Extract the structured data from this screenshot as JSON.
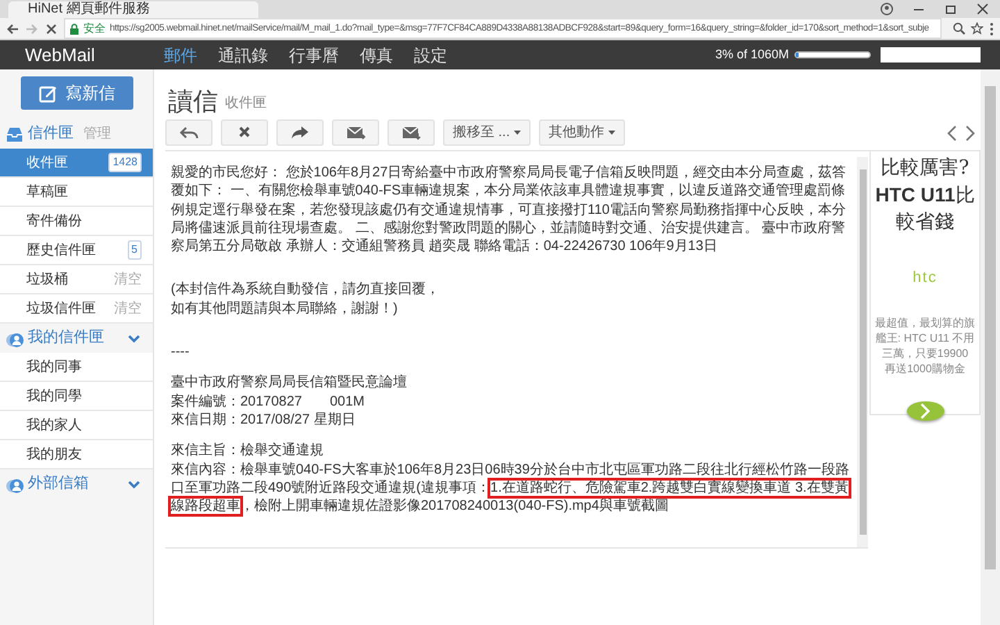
{
  "browser": {
    "tab_title": "HiNet 網頁郵件服務",
    "security_label": "安全",
    "url": "https://sg2005.webmail.hinet.net/mailService/mail/M_mail_1.do?mail_type=&msg=77F7CF84CA889D4338A88138ADBCF928&start=89&query_form=16&query_string=&folder_id=170&sort_method=1&sort_subje"
  },
  "navbar": {
    "brand": "WebMail",
    "items": [
      {
        "label": "郵件",
        "selected": true
      },
      {
        "label": "通訊錄",
        "selected": false
      },
      {
        "label": "行事曆",
        "selected": false
      },
      {
        "label": "傳真",
        "selected": false
      },
      {
        "label": "設定",
        "selected": false
      }
    ],
    "quota": {
      "text": "3% of 1060M",
      "level": 0.03
    }
  },
  "compose_button": "寫新信",
  "sidebar": {
    "sections": [
      {
        "kind": "inbox",
        "title": "信件匣",
        "action": "管理",
        "items": [
          {
            "label": "收件匣",
            "badge": "1428",
            "selected": true
          },
          {
            "label": "草稿匣",
            "selected": false
          },
          {
            "label": "寄件備份",
            "selected": false
          },
          {
            "label": "歷史信件匣",
            "badge": "5",
            "selected": false
          },
          {
            "label": "垃圾桶",
            "action": "清空",
            "selected": false
          },
          {
            "label": "垃圾信件匣",
            "action": "清空",
            "selected": false
          }
        ]
      },
      {
        "kind": "contacts",
        "title": "我的信件匣",
        "items": [
          {
            "label": "我的同事",
            "selected": false
          },
          {
            "label": "我的同學",
            "selected": false
          },
          {
            "label": "我的家人",
            "selected": false
          },
          {
            "label": "我的朋友",
            "selected": false
          }
        ]
      },
      {
        "kind": "contacts",
        "title": "外部信箱"
      }
    ]
  },
  "page_header": {
    "title": "讀信",
    "subtitle": "收件匣"
  },
  "toolbar": {
    "move_menu": "搬移至 ...",
    "more_menu": "其他動作"
  },
  "message": {
    "paragraph": "親愛的市民您好： 您於106年8月27日寄給臺中市政府警察局局長電子信箱反映問題，經交由本分局查處，茲答覆如下： 一、有關您檢舉車號040-FS車輛違規案，本分局業依該車具體違規事實，以違反道路交通管理處罰條例規定逕行舉發在案，若您發現該處仍有交通違規情事，可直接撥打110電話向警察局勤務指揮中心反映，本分局將儘速派員前往現場查處。 二、感謝您對警政問題的關心，並請隨時對交通、治安提供建言。 臺中市政府警察局第五分局敬啟 承辦人：交通組警務員 趙奕晟 聯絡電話：04-22426730 106年9月13日",
    "notice": [
      "(本封信件為系統自動發信，請勿直接回覆，",
      "如有其他問題請與本局聯絡，謝謝！)"
    ],
    "separator": "----",
    "case_info": [
      "臺中市政府警察局局長信箱暨民意論壇",
      "案件編號：20170827　　001M",
      "來信日期：2017/08/27 星期日"
    ],
    "subject": "來信主旨：檢舉交通違規",
    "content": {
      "before": "來信內容：檢舉車號040-FS大客車於106年8月23日06時39分於台中市北屯區軍功路二段往北行經松竹路一段路口至軍功路二段490號附近路段交通違規(違規事項：",
      "highlighted": "1.在道路蛇行、危險駕車2.跨越雙白實線變換車道 3.在雙黃線路段超車",
      "after": "，檢附上開車輛違規佐證影像201708240013(040-FS).mp4與車號截圖"
    }
  },
  "ad": {
    "headline": "比較厲害? **HTC U11**比較省錢",
    "logo": "htc",
    "description": "最超值，最划算的旗艦王: HTC U11 不用三萬，只要19900 再送1000購物金"
  }
}
